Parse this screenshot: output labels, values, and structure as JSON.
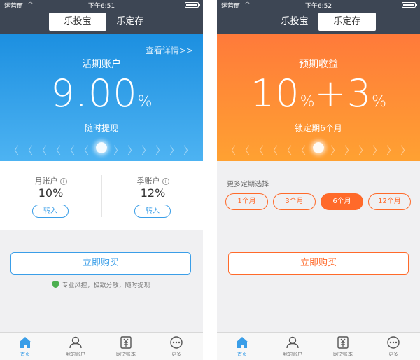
{
  "status": {
    "carrier": "运营商",
    "wifi": "wifi-icon",
    "battery": "battery-icon"
  },
  "left": {
    "time": "下午6:51",
    "tabs": [
      "乐投宝",
      "乐定存"
    ],
    "hero": {
      "detail": "查看详情>>",
      "title": "活期账户",
      "rate": "9.00",
      "unit": "%",
      "sub": "随时提现"
    },
    "accounts": [
      {
        "label": "月账户",
        "value": "10%",
        "button": "转入"
      },
      {
        "label": "季账户",
        "value": "12%",
        "button": "转入"
      }
    ],
    "buy": "立即购买",
    "note": "专业风控，极致分散，随时提现"
  },
  "right": {
    "time": "下午6:52",
    "tabs": [
      "乐投宝",
      "乐定存"
    ],
    "hero": {
      "title": "预期收益",
      "rate_a": "10",
      "unit_a": "%",
      "plus": "+3",
      "unit_b": "%",
      "sub": "锁定期6个月"
    },
    "more_label": "更多定期选择",
    "options": [
      "1个月",
      "3个月",
      "6个月",
      "12个月"
    ],
    "selected_option": "6个月",
    "buy": "立即购买"
  },
  "tabbar": [
    {
      "label": "首页",
      "icon": "home-icon"
    },
    {
      "label": "我的账户",
      "icon": "user-icon"
    },
    {
      "label": "网贷账本",
      "icon": "ledger-icon"
    },
    {
      "label": "更多",
      "icon": "more-icon"
    }
  ],
  "colors": {
    "nav": "#3d4654",
    "blue": "#3a9ee8",
    "orange": "#ff6a2a",
    "active_tab": "#3a9ee8"
  }
}
